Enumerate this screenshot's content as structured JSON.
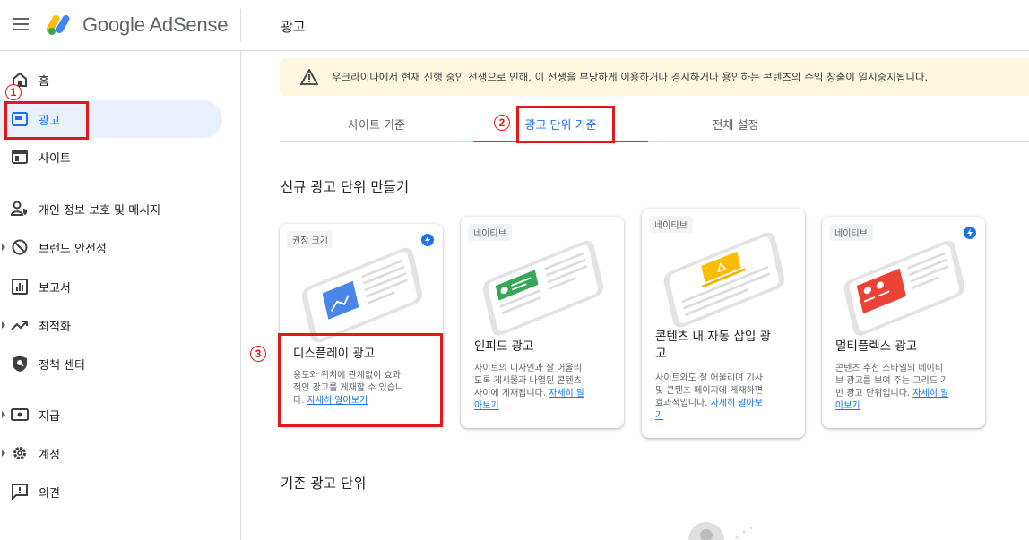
{
  "header": {
    "brand": "Google AdSense",
    "page_title": "광고"
  },
  "sidebar": {
    "items": [
      {
        "label": "홈",
        "icon": "home-icon"
      },
      {
        "label": "광고",
        "icon": "ads-icon",
        "active": true
      },
      {
        "label": "사이트",
        "icon": "sites-icon"
      },
      {
        "label": "개인 정보 보호 및 메시지",
        "icon": "privacy-icon"
      },
      {
        "label": "브랜드 안전성",
        "icon": "block-icon"
      },
      {
        "label": "보고서",
        "icon": "reports-icon"
      },
      {
        "label": "최적화",
        "icon": "trending-icon"
      },
      {
        "label": "정책 센터",
        "icon": "shield-icon"
      },
      {
        "label": "지급",
        "icon": "payments-icon"
      },
      {
        "label": "계정",
        "icon": "gear-icon"
      },
      {
        "label": "의견",
        "icon": "feedback-icon"
      }
    ]
  },
  "annotations": {
    "step1": "1",
    "step2": "2",
    "step3": "3"
  },
  "alert": {
    "text": "우크라이나에서 현재 진행 중인 전쟁으로 인해, 이 전쟁을 부당하게 이용하거나 경시하거나 용인하는 콘텐츠의 수익 창출이 일시중지됩니다."
  },
  "tabs": [
    {
      "label": "사이트 기준"
    },
    {
      "label": "광고 단위 기준",
      "active": true
    },
    {
      "label": "전체 설정"
    }
  ],
  "new_units": {
    "title": "신규 광고 단위 만들기",
    "cards": [
      {
        "badge": "권장 크기",
        "name": "디스플레이 광고",
        "desc_1": "용도와 위치에 관계없이 효과",
        "desc_2": "적인 광고를 게재할 수 있습니",
        "desc_3": "다. ",
        "link_1": "자세히 알아보기",
        "link_2": ""
      },
      {
        "badge": "네이티브",
        "name": "인피드 광고",
        "desc_1": "사이트의 디자인과 잘 어울리",
        "desc_2": "도록 게시물과 나열된 콘텐츠",
        "desc_3": "사이에 게재됩니다. ",
        "link_1": "자세히 알",
        "link_2": "아보기"
      },
      {
        "badge": "네이티브",
        "name_1": "콘텐츠 내 자동 삽입 광",
        "name_2": "고",
        "desc_1": "사이트와도 잘 어울리며 기사",
        "desc_2": "및 콘텐츠 페이지에 게재하면",
        "desc_3": "효과적입니다. ",
        "link_1": "자세히 알아보",
        "link_2": "기"
      },
      {
        "badge": "네이티브",
        "name": "멀티플렉스 광고",
        "desc_1": "콘텐츠 추천 스타일의 네이티",
        "desc_2": "브 광고를 보여 주는 그리드 기",
        "desc_3": "반 광고 단위입니다. ",
        "link_1": "자세히 알",
        "link_2": "아보기"
      }
    ]
  },
  "existing_units": {
    "title": "기존 광고 단위"
  },
  "colors": {
    "accent": "#1a73e8",
    "annotation": "#e2191a",
    "alert_bg": "#fef7e0"
  }
}
